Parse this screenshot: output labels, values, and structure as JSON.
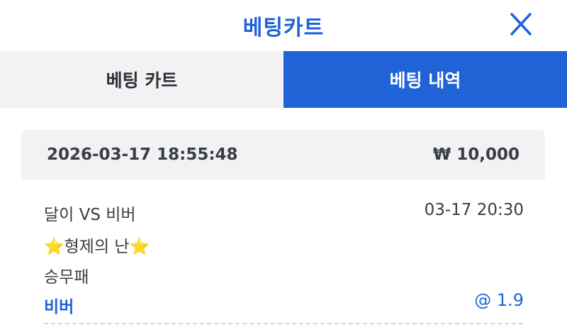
{
  "header": {
    "title": "베팅카트",
    "close_icon": "close-icon"
  },
  "tabs": [
    {
      "label": "베팅 카트",
      "active": false
    },
    {
      "label": "베팅 내역",
      "active": true
    }
  ],
  "bet": {
    "datetime": "2026-03-17 18:55:48",
    "amount": "₩ 10,000",
    "match": "달이 VS 비버",
    "match_time": "03-17 20:30",
    "league_star_left": "⭐",
    "league": "형제의 난",
    "league_star_right": "⭐",
    "market": "승무패",
    "pick": "비버",
    "odds": "@ 1.9"
  },
  "colors": {
    "accent": "#1f63d6",
    "panel": "#f1f2f4",
    "text": "#3a3d42"
  }
}
